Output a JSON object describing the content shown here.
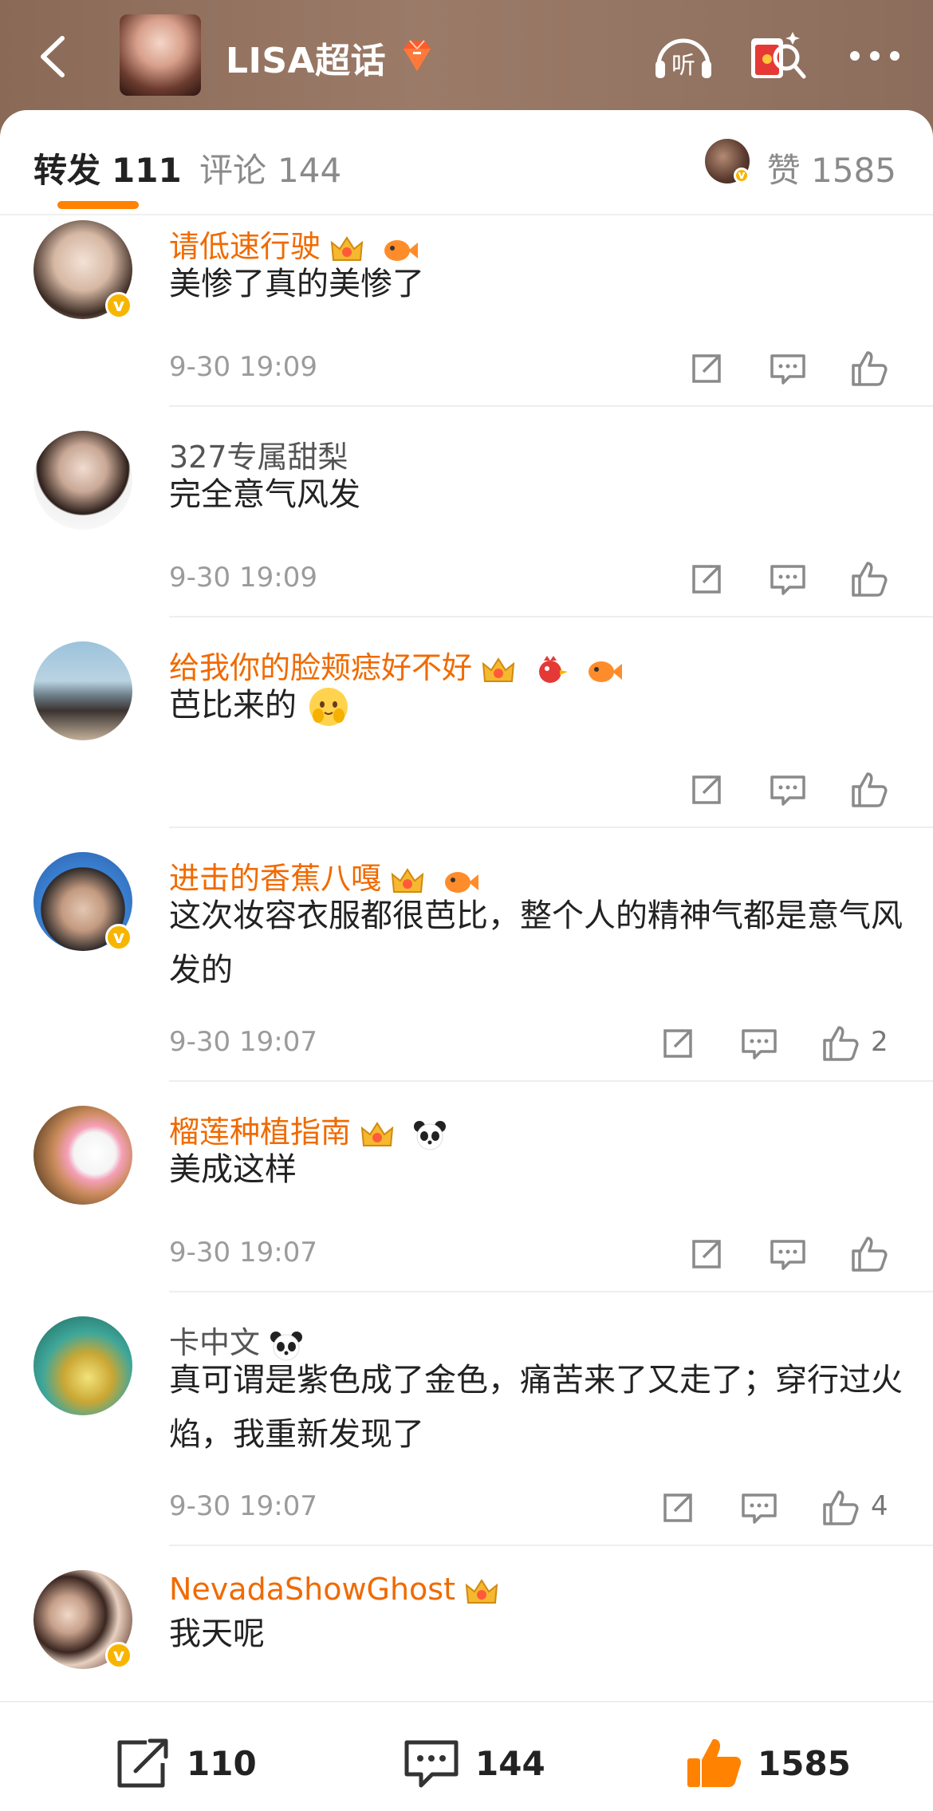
{
  "header": {
    "title": "LISA超话",
    "back_icon": "chevron-left-icon",
    "listen_icon": "headphones-icon",
    "listen_label": "听",
    "gift_icon": "red-envelope-icon",
    "more_icon": "more-icon"
  },
  "tabs": {
    "repost_label": "转发",
    "repost_count": "111",
    "comment_label": "评论",
    "comment_count": "144",
    "likes_label": "赞 1585",
    "active": "repost"
  },
  "comments": [
    {
      "name": "请低速行驶",
      "vip": true,
      "text": "美惨了真的美惨了",
      "time": "9-30 19:09",
      "likes": ""
    },
    {
      "name": "327专属甜梨",
      "vip": false,
      "text": "完全意气风发",
      "time": "9-30 19:09",
      "likes": ""
    },
    {
      "name": "给我你的脸颊痣好不好",
      "vip": true,
      "text": "芭比来的",
      "time": "",
      "likes": ""
    },
    {
      "name": "进击的香蕉八嘎",
      "vip": true,
      "text": "这次妆容衣服都很芭比，整个人的精神气都是意气风发的",
      "time": "9-30 19:07",
      "likes": "2"
    },
    {
      "name": "榴莲种植指南",
      "vip": true,
      "text": "美成这样",
      "time": "9-30 19:07",
      "likes": ""
    },
    {
      "name": "卡中文",
      "vip": false,
      "text": "真可谓是紫色成了金色，痛苦来了又走了；穿行过火焰，我重新发现了",
      "time": "9-30 19:07",
      "likes": "4"
    },
    {
      "name": "NevadaShowGhost",
      "vip": true,
      "text": "我天呢",
      "time": "",
      "likes": ""
    }
  ],
  "verified_mark": "v",
  "bottom": {
    "repost_count": "110",
    "comment_count": "144",
    "like_count": "1585"
  },
  "colors": {
    "accent": "#ff8200",
    "vip_name": "#f06a00",
    "verified": "#f7b500"
  }
}
